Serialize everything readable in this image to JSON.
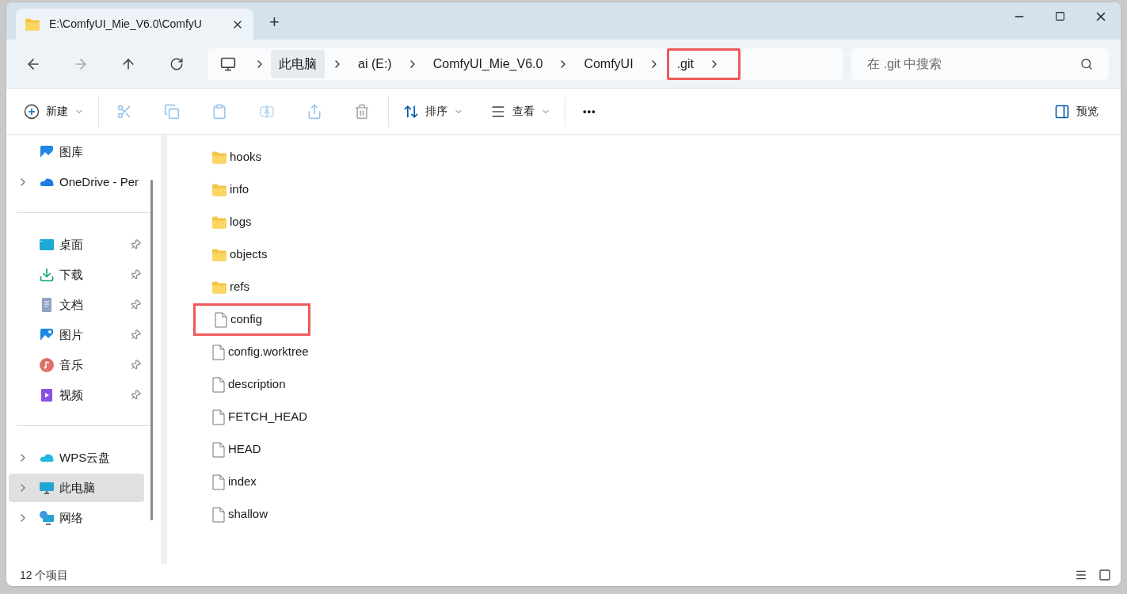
{
  "window": {
    "tab_title": "E:\\ComfyUI_Mie_V6.0\\ComfyU",
    "new_tab": "+"
  },
  "address_bar": {
    "crumbs": [
      {
        "label": "此电脑",
        "selected": true,
        "highlighted": false
      },
      {
        "label": "ai (E:)",
        "selected": false,
        "highlighted": false
      },
      {
        "label": "ComfyUI_Mie_V6.0",
        "selected": false,
        "highlighted": false
      },
      {
        "label": "ComfyUI",
        "selected": false,
        "highlighted": false
      },
      {
        "label": ".git",
        "selected": false,
        "highlighted": true
      }
    ],
    "search_placeholder": "在 .git 中搜索"
  },
  "toolbar": {
    "new": "新建",
    "sort": "排序",
    "view": "查看",
    "more": "•••",
    "preview": "预览"
  },
  "sidebar": {
    "groups": [
      [
        {
          "label": "图库"
        },
        {
          "label": "OneDrive - Per",
          "expanded": false
        }
      ],
      [
        {
          "label": "桌面",
          "pinned": true
        },
        {
          "label": "下载",
          "pinned": true
        },
        {
          "label": "文档",
          "pinned": true
        },
        {
          "label": "图片",
          "pinned": true
        },
        {
          "label": "音乐",
          "pinned": true
        },
        {
          "label": "视频",
          "pinned": true
        }
      ],
      [
        {
          "label": "WPS云盘",
          "expanded": false,
          "selected": false
        },
        {
          "label": "此电脑",
          "expanded": false,
          "selected": true
        },
        {
          "label": "网络",
          "expanded": false,
          "selected": false
        }
      ]
    ]
  },
  "files": [
    {
      "name": "hooks",
      "kind": "folder",
      "highlighted": false
    },
    {
      "name": "info",
      "kind": "folder",
      "highlighted": false
    },
    {
      "name": "logs",
      "kind": "folder",
      "highlighted": false
    },
    {
      "name": "objects",
      "kind": "folder",
      "highlighted": false
    },
    {
      "name": "refs",
      "kind": "folder",
      "highlighted": false
    },
    {
      "name": "config",
      "kind": "file",
      "highlighted": true
    },
    {
      "name": "config.worktree",
      "kind": "file",
      "highlighted": false
    },
    {
      "name": "description",
      "kind": "file",
      "highlighted": false
    },
    {
      "name": "FETCH_HEAD",
      "kind": "file",
      "highlighted": false
    },
    {
      "name": "HEAD",
      "kind": "file",
      "highlighted": false
    },
    {
      "name": "index",
      "kind": "file",
      "highlighted": false
    },
    {
      "name": "shallow",
      "kind": "file",
      "highlighted": false
    }
  ],
  "status_bar": {
    "count": "12 个项目"
  }
}
